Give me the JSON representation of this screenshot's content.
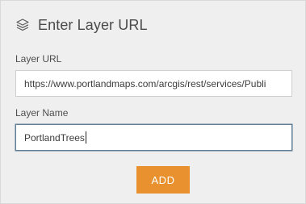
{
  "dialog": {
    "title": "Enter Layer URL",
    "header_icon": "layers-icon"
  },
  "form": {
    "layer_url": {
      "label": "Layer URL",
      "value": "https://www.portlandmaps.com/arcgis/rest/services/Publi"
    },
    "layer_name": {
      "label": "Layer Name",
      "value": "PortlandTrees"
    },
    "add_label": "ADD"
  },
  "colors": {
    "panel_background": "#efefef",
    "accent_button": "#e8912e",
    "focused_border": "#5f7f99"
  }
}
